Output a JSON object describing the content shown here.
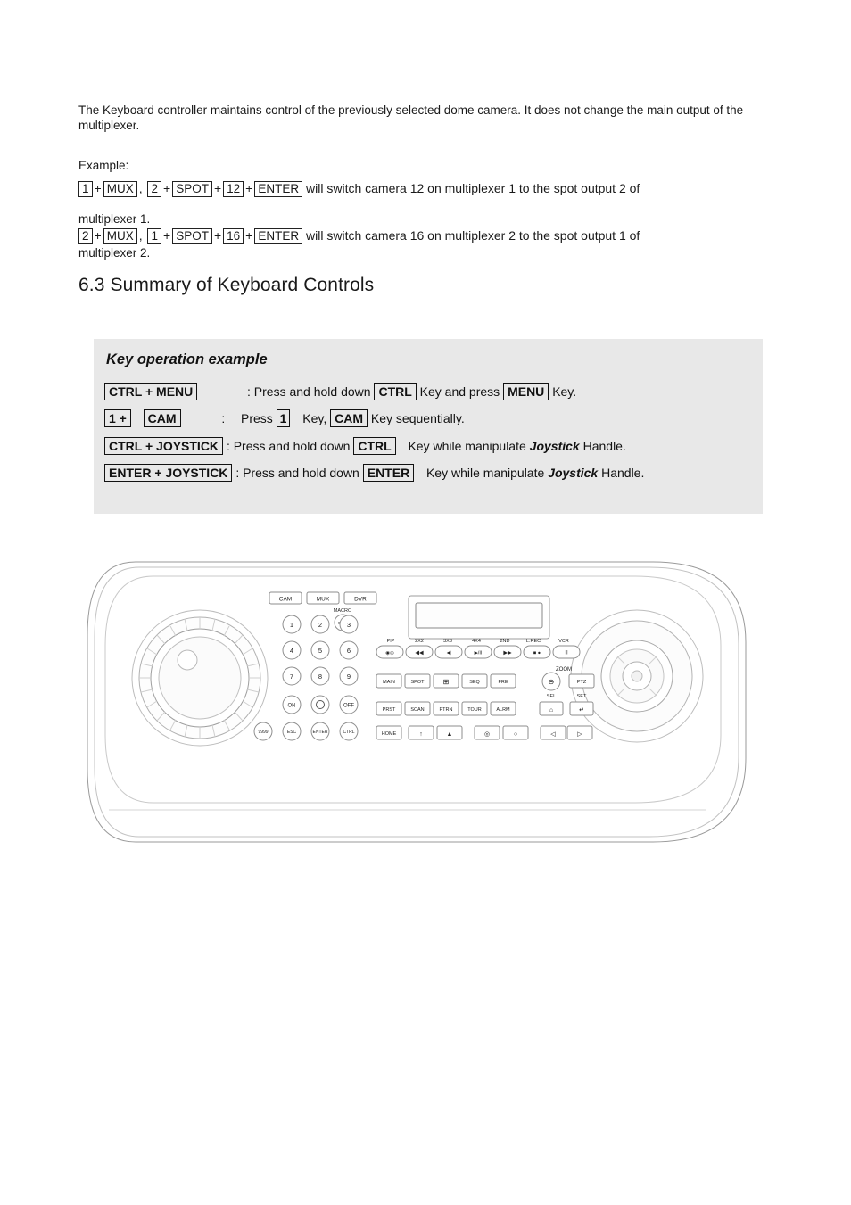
{
  "intro": {
    "paragraph": "The Keyboard controller maintains control of the previously selected dome camera. It does not change the main output of the multiplexer.",
    "example_label": "Example:"
  },
  "examples": [
    {
      "tokens": [
        "1",
        "MUX",
        "2",
        "SPOT",
        "12",
        "ENTER"
      ],
      "text_after": "will switch camera 12 on multiplexer 1 to the spot output 2 of",
      "continuation": "multiplexer 1."
    },
    {
      "tokens": [
        "2",
        "MUX",
        "1",
        "SPOT",
        "16",
        "ENTER"
      ],
      "text_after": "will switch camera 16 on multiplexer 2 to the spot output 1 of",
      "continuation": "multiplexer 2."
    }
  ],
  "section": {
    "number": "6.3",
    "title": "Summary of Keyboard Controls"
  },
  "key_operation": {
    "title": "Key operation example",
    "rows": [
      {
        "combo": "CTRL + MENU",
        "colon": ": Press and hold down",
        "key1": "CTRL",
        "mid": "Key and press",
        "key2": "MENU",
        "tail": "Key."
      },
      {
        "combo_a": "1 +",
        "combo_b": "CAM",
        "colon": ":",
        "press": "Press",
        "key1": "1",
        "mid": "Key,",
        "key2": "CAM",
        "tail": "Key sequentially."
      },
      {
        "combo": "CTRL + JOYSTICK",
        "colon": ": Press and hold down",
        "key1": "CTRL",
        "mid": "Key while manipulate",
        "emph": "Joystick",
        "tail": "Handle."
      },
      {
        "combo": "ENTER + JOYSTICK",
        "colon": ": Press and hold down",
        "key1": "ENTER",
        "mid": "Key while manipulate",
        "emph": "Joystick",
        "tail": "Handle."
      }
    ]
  },
  "device": {
    "top_buttons": [
      "CAM",
      "MUX",
      "DVR"
    ],
    "macro_label": "MACRO",
    "macro_key": "9999",
    "numeric_keys": [
      "1",
      "2",
      "3",
      "4",
      "5",
      "6",
      "7",
      "8",
      "9"
    ],
    "power_keys": [
      "ON",
      "0",
      "OFF"
    ],
    "bottom_left_keys": [
      "9999",
      "ESC",
      "ENTER",
      "CTRL"
    ],
    "playback_labels": [
      "PIP",
      "2X2",
      "3X3",
      "4X4",
      "2ND",
      "L.REC",
      "VCR"
    ],
    "playback_icons": [
      "◉◎",
      "◀◀",
      "◀",
      "▶/II",
      "▶▶",
      "■ ●",
      "II"
    ],
    "row_main": [
      "MAIN",
      "SPOT",
      "⊞",
      "SEQ",
      "FRE"
    ],
    "zoom_label": "ZOOM",
    "zoom_keys": [
      "⊖",
      "PTZ"
    ],
    "row_prst": [
      "PRST",
      "SCAN",
      "PTRN",
      "TOUR",
      "ALRM"
    ],
    "sel_label": "SEL",
    "set_label": "SET",
    "sel_set_keys": [
      "⌂",
      "↵"
    ],
    "row_home": [
      "HOME",
      "↑",
      "▲",
      "◎",
      "○",
      "◁",
      "▷"
    ]
  }
}
